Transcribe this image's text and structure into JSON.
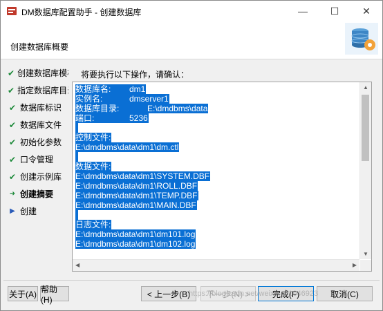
{
  "window": {
    "title": "DM数据库配置助手 - 创建数据库",
    "controls": {
      "minimize": "—",
      "maximize": "☐",
      "close": "✕"
    }
  },
  "header": {
    "title": "创建数据库概要"
  },
  "nav": {
    "items": [
      {
        "label": "创建数据库模板",
        "state": "done"
      },
      {
        "label": "指定数据库目录",
        "state": "done"
      },
      {
        "label": "数据库标识",
        "state": "done"
      },
      {
        "label": "数据库文件",
        "state": "done"
      },
      {
        "label": "初始化参数",
        "state": "done"
      },
      {
        "label": "口令管理",
        "state": "done"
      },
      {
        "label": "创建示例库",
        "state": "done"
      },
      {
        "label": "创建摘要",
        "state": "current"
      },
      {
        "label": "创建",
        "state": "pending"
      }
    ]
  },
  "main": {
    "confirm_label": "将要执行以下操作，请确认：",
    "summary": {
      "db_name_label": "数据库名:",
      "db_name_value": "dm1",
      "instance_label": "实例名:",
      "instance_value": "dmserver1",
      "dir_label": "数据库目录:",
      "dir_value": "E:\\dmdbms\\data",
      "port_label": "端口:",
      "port_value": "5236",
      "control_label": "控制文件:",
      "control_file": "E:\\dmdbms\\data\\dm1\\dm.ctl",
      "data_label": "数据文件:",
      "data_files": [
        "E:\\dmdbms\\data\\dm1\\SYSTEM.DBF",
        "E:\\dmdbms\\data\\dm1\\ROLL.DBF",
        "E:\\dmdbms\\data\\dm1\\TEMP.DBF",
        "E:\\dmdbms\\data\\dm1\\MAIN.DBF"
      ],
      "log_label": "日志文件:",
      "log_files": [
        "E:\\dmdbms\\data\\dm1\\dm101.log",
        "E:\\dmdbms\\data\\dm1\\dm102.log"
      ]
    }
  },
  "buttons": {
    "about": "关于(A)",
    "help": "帮助(H)",
    "prev": "< 上一步(B)",
    "next": "下一步(N) >",
    "finish": "完成(F)",
    "cancel": "取消(C)"
  },
  "watermark": "https://blog.csdn.net/weixin_51046923",
  "colors": {
    "selection": "#0a6fd4",
    "check": "#1d8a3a",
    "focus": "#0078d7"
  }
}
